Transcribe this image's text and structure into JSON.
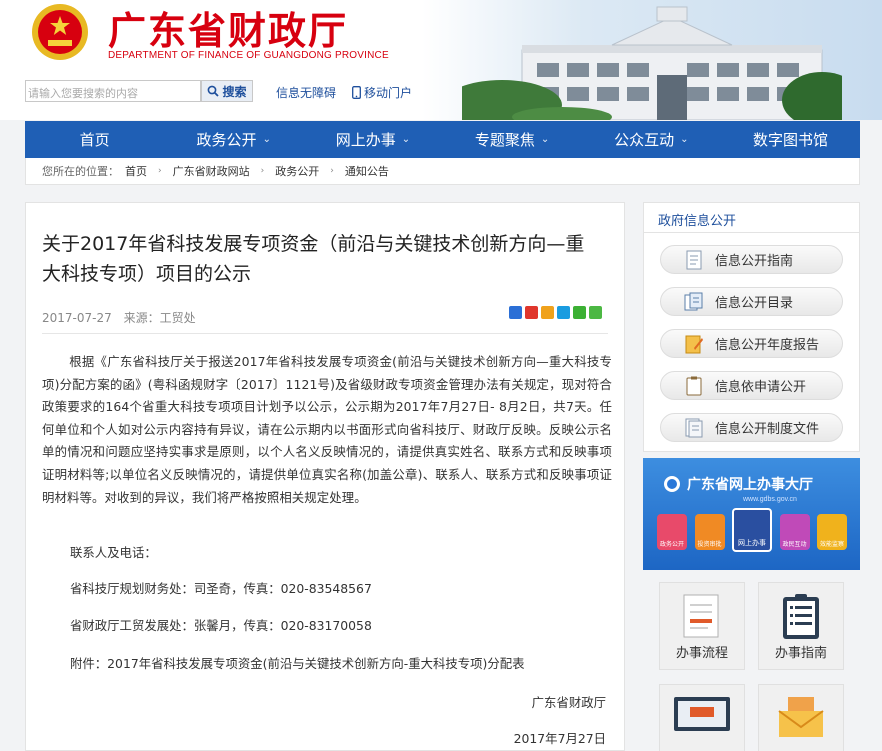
{
  "header": {
    "title": "广东省财政厅",
    "subtitle": "DEPARTMENT OF FINANCE OF GUANGDONG PROVINCE",
    "search_placeholder": "请输入您要搜索的内容",
    "search_button": "搜索",
    "accessibility_link": "信息无障碍",
    "mobile_link": "移动门户"
  },
  "nav": {
    "items": [
      {
        "label": "首页",
        "has_dropdown": false
      },
      {
        "label": "政务公开",
        "has_dropdown": true
      },
      {
        "label": "网上办事",
        "has_dropdown": true
      },
      {
        "label": "专题聚焦",
        "has_dropdown": true
      },
      {
        "label": "公众互动",
        "has_dropdown": true
      },
      {
        "label": "数字图书馆",
        "has_dropdown": false
      }
    ],
    "chevron": "⌄"
  },
  "breadcrumb": {
    "prefix": "您所在的位置：",
    "items": [
      "首页",
      "广东省财政网站",
      "政务公开",
      "通知公告"
    ],
    "separator": "›"
  },
  "article": {
    "title": "关于2017年省科技发展专项资金（前沿与关键技术创新方向—重大科技专项）项目的公示",
    "date": "2017-07-27",
    "source": "来源：工贸处",
    "body": "根据《广东省科技厅关于报送2017年省科技发展专项资金(前沿与关键技术创新方向—重大科技专项)分配方案的函》(粤科函规财字〔2017〕1121号)及省级财政专项资金管理办法有关规定，现对符合政策要求的164个省重大科技专项项目计划予以公示，公示期为2017年7月27日- 8月2日，共7天。任何单位和个人如对公示内容持有异议，请在公示期内以书面形式向省科技厅、财政厅反映。反映公示名单的情况和问题应坚持实事求是原则，以个人名义反映情况的，请提供真实姓名、联系方式和反映事项证明材料等;以单位名义反映情况的，请提供单位真实名称(加盖公章)、联系人、联系方式和反映事项证明材料等。对收到的异议，我们将严格按照相关规定处理。",
    "contact_heading": "联系人及电话：",
    "contact_1": "省科技厅规划财务处：司圣奇，传真：020-83548567",
    "contact_2": "省财政厅工贸发展处：张馨月，传真：020-83170058",
    "attachment": "附件：2017年省科技发展专项资金(前沿与关键技术创新方向-重大科技专项)分配表",
    "signature_org": "广东省财政厅",
    "signature_date": "2017年7月27日",
    "share_icons": [
      "qzone-icon",
      "weibo-icon",
      "renren-icon",
      "tencent-weibo-icon",
      "wechat-icon",
      "more-share-icon"
    ]
  },
  "sidebar": {
    "info_heading": "政府信息公开",
    "info_items": [
      "信息公开指南",
      "信息公开目录",
      "信息公开年度报告",
      "信息依申请公开",
      "信息公开制度文件"
    ],
    "banner_title": "广东省网上办事大厅",
    "banner_url": "www.gdbs.gov.cn",
    "banner_figures": [
      "政务公开",
      "投资审批",
      "网上办事",
      "政民互动",
      "效能监察"
    ],
    "tiles": [
      "办事流程",
      "办事指南",
      "",
      ""
    ]
  },
  "colors": {
    "brand_red": "#d7000f",
    "nav_blue": "#1f5fb5",
    "link_blue": "#1e4f9c"
  }
}
